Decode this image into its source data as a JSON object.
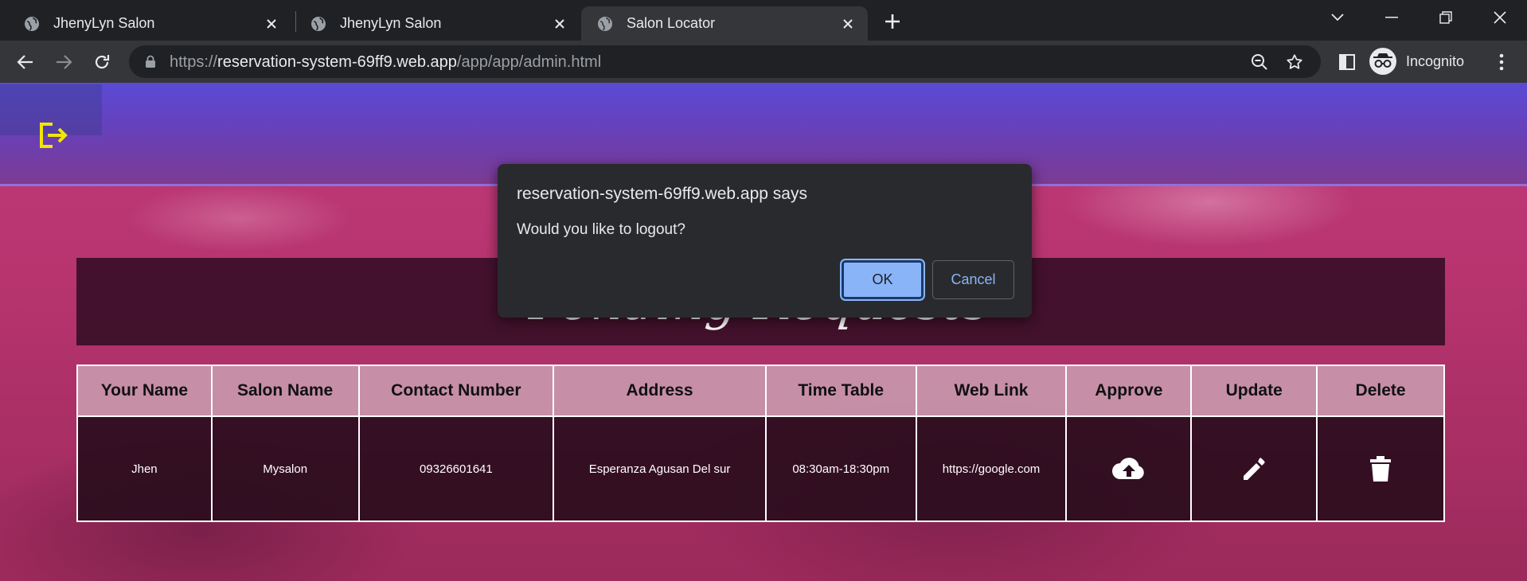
{
  "browser": {
    "tabs": [
      {
        "title": "JhenyLyn Salon",
        "active": false
      },
      {
        "title": "JhenyLyn Salon",
        "active": false
      },
      {
        "title": "Salon Locator",
        "active": true
      }
    ],
    "url": {
      "scheme": "https://",
      "host": "reservation-system-69ff9.web.app",
      "path": "/app/app/admin.html"
    },
    "profile_label": "Incognito"
  },
  "page": {
    "title": "Pending Requests",
    "table": {
      "headers": [
        "Your Name",
        "Salon Name",
        "Contact Number",
        "Address",
        "Time Table",
        "Web Link",
        "Approve",
        "Update",
        "Delete"
      ],
      "rows": [
        {
          "your_name": "Jhen",
          "salon_name": "Mysalon",
          "contact_number": "09326601641",
          "address": "Esperanza Agusan Del sur",
          "time_table": "08:30am-18:30pm",
          "web_link": "https://google.com",
          "approve_icon": "cloud-upload-icon",
          "update_icon": "pencil-icon",
          "delete_icon": "trash-icon"
        }
      ]
    }
  },
  "dialog": {
    "title": "reservation-system-69ff9.web.app says",
    "message": "Would you like to logout?",
    "ok_label": "OK",
    "cancel_label": "Cancel"
  },
  "colors": {
    "accent_blue": "#8ab4f8",
    "logout_icon": "#f2e600"
  }
}
